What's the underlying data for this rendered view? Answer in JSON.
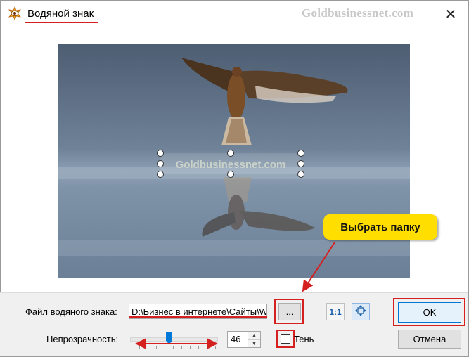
{
  "window": {
    "title": "Водяной знак",
    "site_watermark": "Goldbusinessnet.com",
    "close_icon": "close-icon"
  },
  "preview": {
    "watermark_text": "Goldbusinessnet.com"
  },
  "annotation": {
    "callout_text": "Выбрать папку",
    "accent_color": "#d52020",
    "callout_color": "#ffde00"
  },
  "controls": {
    "file_label": "Файл водяного знака:",
    "file_path": "D:\\Бизнес в интернете\\Сайты\\W",
    "browse_label": "...",
    "actual_size_label": "1:1",
    "fit_icon": "fit-to-frame-icon",
    "opacity_label": "Непрозрачность:",
    "opacity_value": "46",
    "opacity_slider_fraction": 0.46,
    "shadow_label": "Тень",
    "shadow_checked": false,
    "ok_label": "OK",
    "cancel_label": "Отмена"
  }
}
